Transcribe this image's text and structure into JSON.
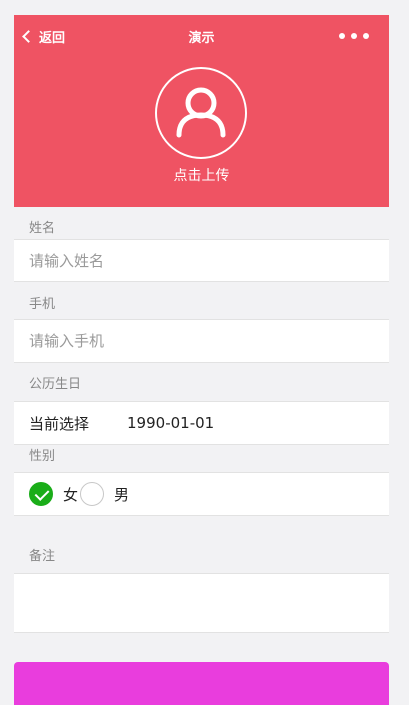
{
  "nav": {
    "back_label": "返回",
    "title": "演示"
  },
  "header": {
    "upload_label": "点击上传"
  },
  "form": {
    "name": {
      "label": "姓名",
      "placeholder": "请输入姓名"
    },
    "phone": {
      "label": "手机",
      "placeholder": "请输入手机"
    },
    "birthday": {
      "label": "公历生日",
      "current_label": "当前选择",
      "value": "1990-01-01"
    },
    "gender": {
      "label": "性别",
      "options": [
        "女",
        "男"
      ],
      "selected": "女"
    },
    "notes": {
      "label": "备注"
    }
  },
  "colors": {
    "header_bg": "#ef5363",
    "submit_bg": "#e93ddd",
    "radio_checked": "#1aad19"
  }
}
